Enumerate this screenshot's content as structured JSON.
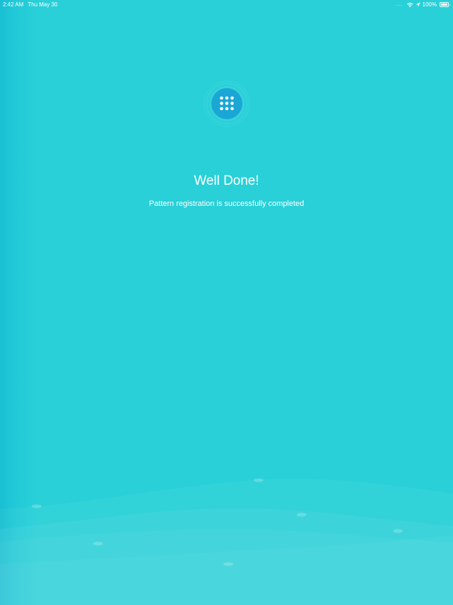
{
  "status_bar": {
    "time": "2:42 AM",
    "date": "Thu May 30",
    "signal": "....",
    "battery_percent": "100%",
    "battery_level": 1.0
  },
  "main": {
    "icon": "keypad-grid-icon",
    "title": "Well Done!",
    "subtitle": "Pattern registration is successfully completed"
  },
  "colors": {
    "background": "#29d0d8",
    "icon_circle": "#1aa7d5",
    "icon_ring": "#48d9e0"
  }
}
